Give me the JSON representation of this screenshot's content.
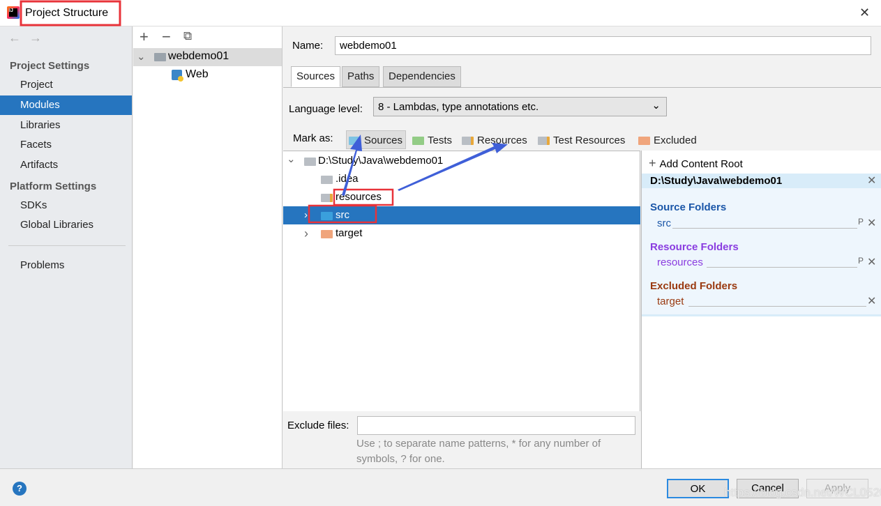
{
  "window": {
    "title": "Project Structure",
    "close": "✕"
  },
  "nav": {
    "back": "←",
    "forward": "→"
  },
  "sidebar": {
    "project_settings_header": "Project Settings",
    "items": [
      {
        "label": "Project"
      },
      {
        "label": "Modules",
        "selected": true
      },
      {
        "label": "Libraries"
      },
      {
        "label": "Facets"
      },
      {
        "label": "Artifacts"
      }
    ],
    "platform_settings_header": "Platform Settings",
    "platform_items": [
      {
        "label": "SDKs"
      },
      {
        "label": "Global Libraries"
      }
    ],
    "problems": "Problems"
  },
  "modules": {
    "toolbar": {
      "add": "+",
      "remove": "−",
      "copy": "⧉"
    },
    "module": "webdemo01",
    "facet": "Web"
  },
  "main": {
    "name_label": "Name:",
    "name_value": "webdemo01",
    "tabs": [
      {
        "label": "Sources",
        "selected": true
      },
      {
        "label": "Paths"
      },
      {
        "label": "Dependencies"
      }
    ],
    "language_level_label": "Language level:",
    "language_level_value": "8 - Lambdas, type annotations etc.",
    "mark_as_label": "Mark as:",
    "mark_as": [
      {
        "label": "Sources",
        "color": "#7ec3e3"
      },
      {
        "label": "Tests",
        "color": "#93cc86"
      },
      {
        "label": "Resources",
        "color": "#b9bec4"
      },
      {
        "label": "Test Resources",
        "color": "#b9bec4"
      },
      {
        "label": "Excluded",
        "color": "#f0a57c"
      }
    ],
    "tree": {
      "root": "D:\\Study\\Java\\webdemo01",
      "children": [
        {
          "label": ".idea",
          "color": "#b9bec4"
        },
        {
          "label": "resources",
          "color": "#b9bec4"
        },
        {
          "label": "src",
          "color": "#3a9fdc",
          "selected": true
        },
        {
          "label": "target",
          "color": "#f0a57c"
        }
      ]
    },
    "exclude_label": "Exclude files:",
    "exclude_value": "",
    "hint_line1": "Use ; to separate name patterns, * for any number of",
    "hint_line2": "symbols, ? for one."
  },
  "content_root": {
    "add_label": "Add Content Root",
    "path": "D:\\Study\\Java\\webdemo01",
    "source_header": "Source Folders",
    "source_items": [
      "src"
    ],
    "resource_header": "Resource Folders",
    "resource_items": [
      "resources"
    ],
    "excluded_header": "Excluded Folders",
    "excluded_items": [
      "target"
    ],
    "prefix_icon": "P",
    "colors": {
      "source": "#1a56a8",
      "resource": "#8a3ce0",
      "excluded": "#9a3a10"
    }
  },
  "footer": {
    "help": "?",
    "ok": "OK",
    "cancel": "Cancel",
    "apply": "Apply",
    "watermark": "https://blog.csdn.net/WCL0520"
  },
  "annotations": {
    "highlight_color": "#e8333a",
    "arrow_color": "#3f5fd8"
  }
}
